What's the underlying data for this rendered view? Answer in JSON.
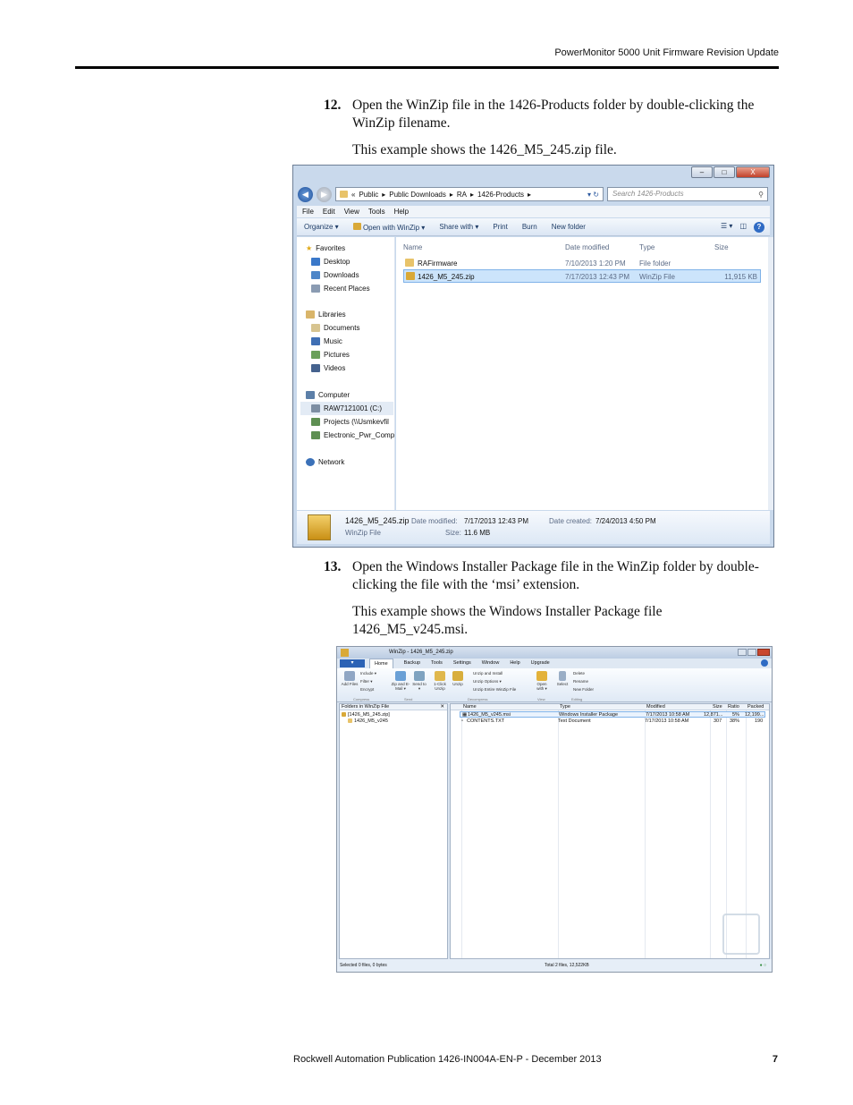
{
  "header": {
    "title": "PowerMonitor 5000 Unit Firmware Revision Update"
  },
  "steps": [
    {
      "num": "12.",
      "text": "Open the WinZip file in the 1426-Products folder by double-clicking the WinZip filename.",
      "note": "This example shows the 1426_M5_245.zip file."
    },
    {
      "num": "13.",
      "text": "Open the Windows Installer Package file in the WinZip folder by double-clicking the file with the ‘msi’ extension.",
      "note": "This example shows the Windows Installer Package file 1426_M5_v245.msi."
    }
  ],
  "explorer": {
    "window_buttons": [
      "–",
      "□",
      "X"
    ],
    "breadcrumb": [
      "«",
      "Public",
      "Public Downloads",
      "RA",
      "1426-Products"
    ],
    "search_placeholder": "Search 1426-Products",
    "menu": [
      "File",
      "Edit",
      "View",
      "Tools",
      "Help"
    ],
    "commands": [
      "Organize ▾",
      "Open with WinZip ▾",
      "Share with ▾",
      "Print",
      "Burn",
      "New folder"
    ],
    "nav": {
      "favorites": "Favorites",
      "favorites_items": [
        "Desktop",
        "Downloads",
        "Recent Places"
      ],
      "libraries": "Libraries",
      "libraries_items": [
        "Documents",
        "Music",
        "Pictures",
        "Videos"
      ],
      "computer": "Computer",
      "computer_items": [
        "RAW7121001 (C:)",
        "Projects (\\\\Usmkevfil",
        "Electronic_Pwr_Comp"
      ],
      "network": "Network"
    },
    "columns": [
      "Name",
      "Date modified",
      "Type",
      "Size"
    ],
    "rows": [
      {
        "name": "RAFirmware",
        "date": "7/10/2013 1:20 PM",
        "type": "File folder",
        "size": ""
      },
      {
        "name": "1426_M5_245.zip",
        "date": "7/17/2013 12:43 PM",
        "type": "WinZip File",
        "size": "11,915 KB"
      }
    ],
    "details": {
      "filename": "1426_M5_245.zip",
      "filetype": "WinZip File",
      "modified_label": "Date modified:",
      "modified": "7/17/2013 12:43 PM",
      "created_label": "Date created:",
      "created": "7/24/2013 4:50 PM",
      "size_label": "Size:",
      "size": "11.6 MB"
    }
  },
  "winzip": {
    "title": "WinZip - 1426_M5_245.zip",
    "file_tab": "▾",
    "tabs": [
      "Home",
      "Backup",
      "Tools",
      "Settings",
      "Window",
      "Help",
      "Upgrade"
    ],
    "ribbon": [
      {
        "label": "Add Files",
        "group": "Compress"
      },
      {
        "label": "Include ▾",
        "group": ""
      },
      {
        "label": "Filter ▾",
        "group": ""
      },
      {
        "label": "Encrypt",
        "group": ""
      },
      {
        "label": "Zip and E-Mail ▾",
        "group": "Send"
      },
      {
        "label": "Send to ▾",
        "group": ""
      },
      {
        "label": "1-Click Unzip",
        "group": "Decompress"
      },
      {
        "label": "Unzip",
        "group": ""
      },
      {
        "label": "Unzip and Install",
        "group": ""
      },
      {
        "label": "Unzip Options ▾",
        "group": ""
      },
      {
        "label": "Unzip Entire WinZip File",
        "group": ""
      },
      {
        "label": "Open with ▾",
        "group": "View"
      },
      {
        "label": "Select",
        "group": "Editing"
      },
      {
        "label": "Delete",
        "group": ""
      },
      {
        "label": "Rename",
        "group": ""
      },
      {
        "label": "New Folder",
        "group": ""
      }
    ],
    "group_labels": [
      "Compress",
      "Send",
      "Decompress",
      "View",
      "Editing"
    ],
    "tree_header": "Folders in WinZip File",
    "tree": [
      "[1426_M5_245.zip]",
      "1426_M5_v245"
    ],
    "columns": [
      "Name",
      "Type",
      "Modified",
      "Size",
      "Ratio",
      "Packed"
    ],
    "rows": [
      {
        "name": "1426_M5_v245.msi",
        "type": "Windows Installer Package",
        "modified": "7/17/2013 10:58 AM",
        "size": "12,871...",
        "ratio": "5%",
        "packed": "12,199..."
      },
      {
        "name": "CONTENTS.TXT",
        "type": "Text Document",
        "modified": "7/17/2013 10:58 AM",
        "size": "307",
        "ratio": "38%",
        "packed": "190"
      }
    ],
    "status_left": "Selected 0 files, 0 bytes",
    "status_mid": "Total 2 files, 12,522KB"
  },
  "footer": {
    "publication": "Rockwell Automation Publication 1426-IN004A-EN-P - December 2013",
    "page": "7"
  },
  "colors": {
    "accent": "#2b62b5",
    "selection": "#cce4fb"
  }
}
